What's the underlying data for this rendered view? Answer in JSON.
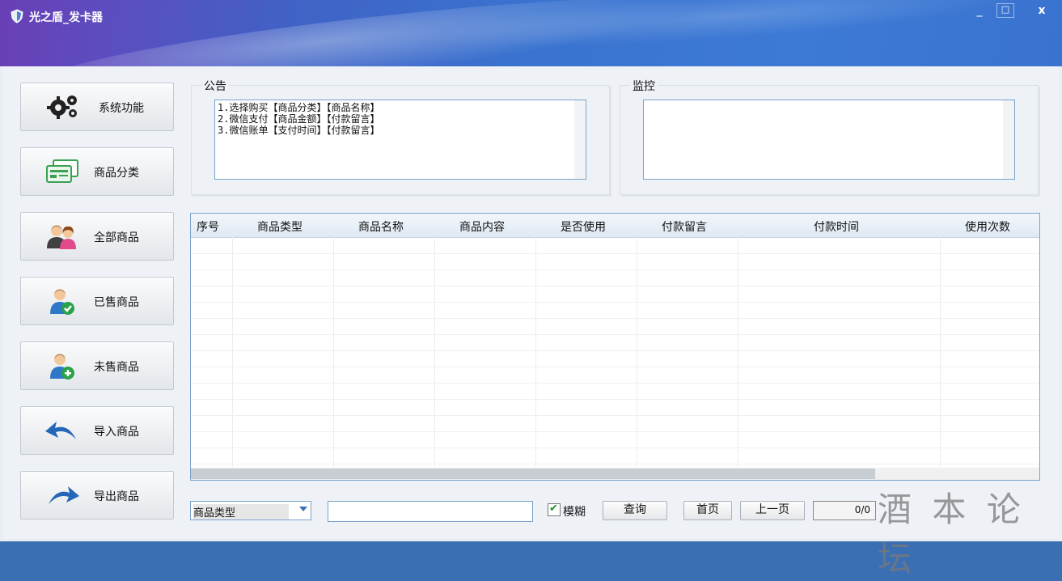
{
  "window": {
    "title": "光之盾_发卡器",
    "minimize": "_",
    "maximize": "□",
    "close": "x"
  },
  "sidebar": {
    "items": [
      {
        "label": "系统功能",
        "icon": "gears-icon"
      },
      {
        "label": "商品分类",
        "icon": "category-cards-icon"
      },
      {
        "label": "全部商品",
        "icon": "users-group-icon"
      },
      {
        "label": "已售商品",
        "icon": "user-check-icon"
      },
      {
        "label": "未售商品",
        "icon": "user-add-icon"
      },
      {
        "label": "导入商品",
        "icon": "import-arrow-icon"
      },
      {
        "label": "导出商品",
        "icon": "export-arrow-icon"
      }
    ]
  },
  "notice": {
    "title": "公告",
    "lines": [
      "1.选择购买【商品分类】【商品名称】",
      "2.微信支付【商品金额】【付款留言】",
      "3.微信账单【支付时间】【付款留言】"
    ]
  },
  "monitor": {
    "title": "监控"
  },
  "table": {
    "columns": [
      "序号",
      "商品类型",
      "商品名称",
      "商品内容",
      "是否使用",
      "付款留言",
      "付款时间",
      "使用次数"
    ]
  },
  "footer": {
    "combo_value": "商品类型",
    "search_value": "",
    "fuzzy_label": "模糊",
    "fuzzy_checked": true,
    "query_label": "查询",
    "first_label": "首页",
    "prev_label": "上一页",
    "page_indicator": "0/0",
    "watermark": "酒 本 论 坛"
  },
  "colors": {
    "title_start": "#6a3fb5",
    "title_end": "#3a73cf",
    "accent_border": "#7aa3c9",
    "check_green": "#1c8f2b"
  }
}
